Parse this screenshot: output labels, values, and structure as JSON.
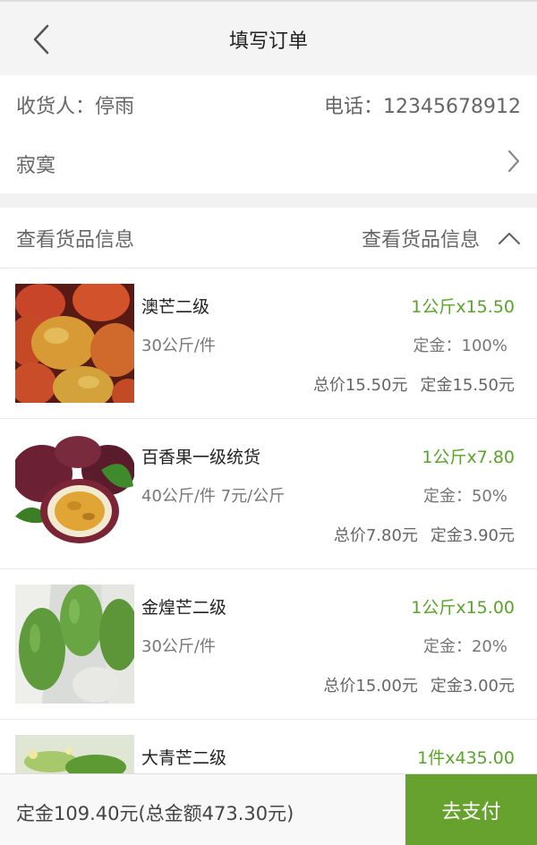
{
  "header": {
    "title": "填写订单"
  },
  "address": {
    "receiver": "收货人：停雨",
    "phone": "电话：12345678912",
    "location": "寂寞"
  },
  "goods_header": {
    "left_label": "查看货品信息",
    "right_label": "查看货品信息"
  },
  "items": [
    {
      "name": "澳芒二级",
      "qty": "1公斤x15.50",
      "spec": "30公斤/件",
      "deposit_rate": "定金：100%",
      "total": "总价15.50元",
      "deposit": "定金15.50元"
    },
    {
      "name": "百香果一级统货",
      "qty": "1公斤x7.80",
      "spec": "40公斤/件  7元/公斤",
      "deposit_rate": "定金：50%",
      "total": "总价7.80元",
      "deposit": "定金3.90元"
    },
    {
      "name": "金煌芒二级",
      "qty": "1公斤x15.00",
      "spec": "30公斤/件",
      "deposit_rate": "定金：20%",
      "total": "总价15.00元",
      "deposit": "定金3.00元"
    },
    {
      "name": "大青芒二级",
      "qty": "1件x435.00"
    }
  ],
  "footer": {
    "summary": "定金109.40元(总金额473.30元)",
    "pay_label": "去支付"
  },
  "colors": {
    "accent_green": "#67a22e",
    "qty_green": "#5aa32b"
  }
}
